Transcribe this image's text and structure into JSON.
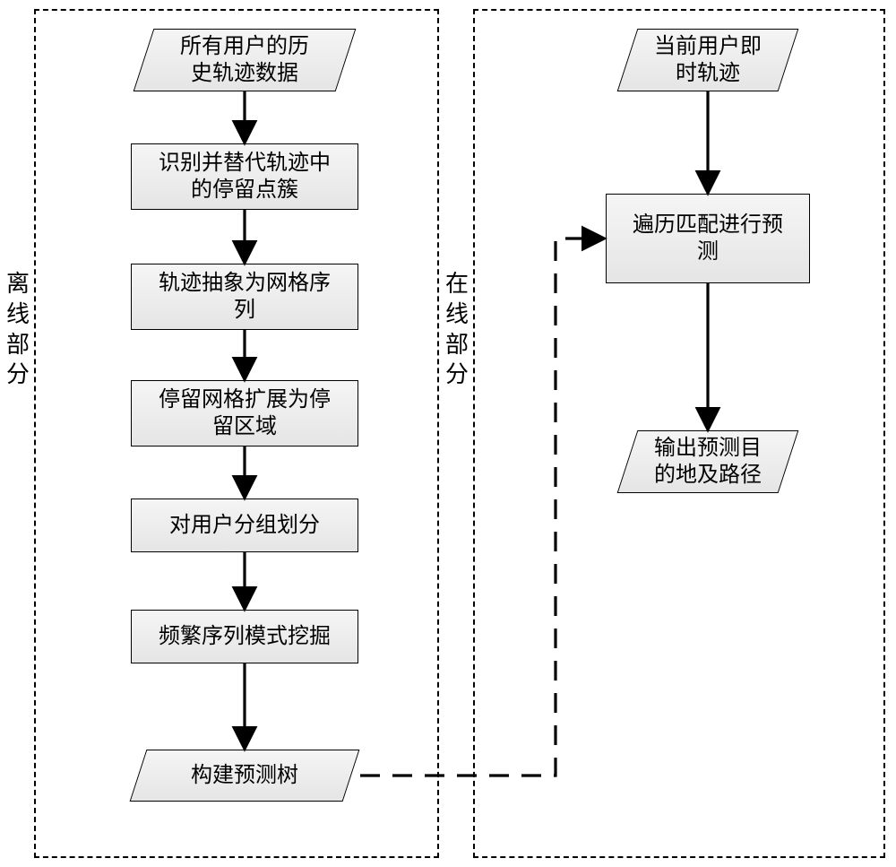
{
  "chart_data": {
    "type": "flowchart",
    "sections": [
      {
        "id": "offline",
        "label": "离线部分",
        "nodes": [
          {
            "id": "n1",
            "type": "io",
            "text": "所有用户的历史轨迹数据"
          },
          {
            "id": "n2",
            "type": "process",
            "text": "识别并替代轨迹中的停留点簇"
          },
          {
            "id": "n3",
            "type": "process",
            "text": "轨迹抽象为网格序列"
          },
          {
            "id": "n4",
            "type": "process",
            "text": "停留网格扩展为停留区域"
          },
          {
            "id": "n5",
            "type": "process",
            "text": "对用户分组划分"
          },
          {
            "id": "n6",
            "type": "process",
            "text": "频繁序列模式挖掘"
          },
          {
            "id": "n7",
            "type": "io",
            "text": "构建预测树"
          }
        ]
      },
      {
        "id": "online",
        "label": "在线部分",
        "nodes": [
          {
            "id": "m1",
            "type": "io",
            "text": "当前用户即时轨迹"
          },
          {
            "id": "m2",
            "type": "process",
            "text": "遍历匹配进行预测"
          },
          {
            "id": "m3",
            "type": "io",
            "text": "输出预测目的地及路径"
          }
        ]
      }
    ],
    "edges": [
      {
        "from": "n1",
        "to": "n2",
        "style": "solid"
      },
      {
        "from": "n2",
        "to": "n3",
        "style": "solid"
      },
      {
        "from": "n3",
        "to": "n4",
        "style": "solid"
      },
      {
        "from": "n4",
        "to": "n5",
        "style": "solid"
      },
      {
        "from": "n5",
        "to": "n6",
        "style": "solid"
      },
      {
        "from": "n6",
        "to": "n7",
        "style": "solid"
      },
      {
        "from": "m1",
        "to": "m2",
        "style": "solid"
      },
      {
        "from": "m2",
        "to": "m3",
        "style": "solid"
      },
      {
        "from": "n7",
        "to": "m2",
        "style": "dashed"
      }
    ]
  },
  "left": {
    "label": "离线部分",
    "n1": "所有用户的历\n史轨迹数据",
    "n2": "识别并替代轨迹中\n的停留点簇",
    "n3": "轨迹抽象为网格序\n列",
    "n4": "停留网格扩展为停\n留区域",
    "n5": "对用户分组划分",
    "n6": "频繁序列模式挖掘",
    "n7": "构建预测树"
  },
  "right": {
    "label": "在线部分",
    "m1": "当前用户即\n时轨迹",
    "m2": "遍历匹配进行预\n测",
    "m3": "输出预测目\n的地及路径"
  }
}
